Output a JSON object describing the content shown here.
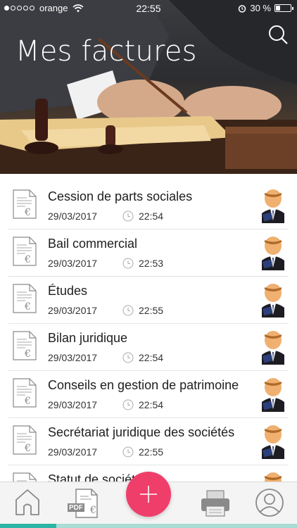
{
  "status_bar": {
    "carrier": "orange",
    "time": "22:55",
    "battery_text": "30 %",
    "battery_level": 0.3
  },
  "header": {
    "title": "Mes factures",
    "search_icon": "search-icon"
  },
  "invoices": [
    {
      "title": "Cession de parts sociales",
      "date": "29/03/2017",
      "time": "22:54"
    },
    {
      "title": "Bail commercial",
      "date": "29/03/2017",
      "time": "22:53"
    },
    {
      "title": "Études",
      "date": "29/03/2017",
      "time": "22:55"
    },
    {
      "title": "Bilan juridique",
      "date": "29/03/2017",
      "time": "22:54"
    },
    {
      "title": "Conseils en gestion de patrimoine",
      "date": "29/03/2017",
      "time": "22:54"
    },
    {
      "title": "Secrétariat juridique des sociétés",
      "date": "29/03/2017",
      "time": "22:55"
    },
    {
      "title": "Statut de société",
      "date": "",
      "time": ""
    }
  ],
  "tabbar": {
    "pdf_label": "PDF",
    "tabs": [
      "home-icon",
      "pdf-invoice-icon",
      "add-icon",
      "printer-icon",
      "user-icon"
    ],
    "progress": 0.19
  },
  "colors": {
    "accent": "#f03e6a",
    "teal": "#2cb5a4",
    "teal_light": "#a9dcd4"
  }
}
